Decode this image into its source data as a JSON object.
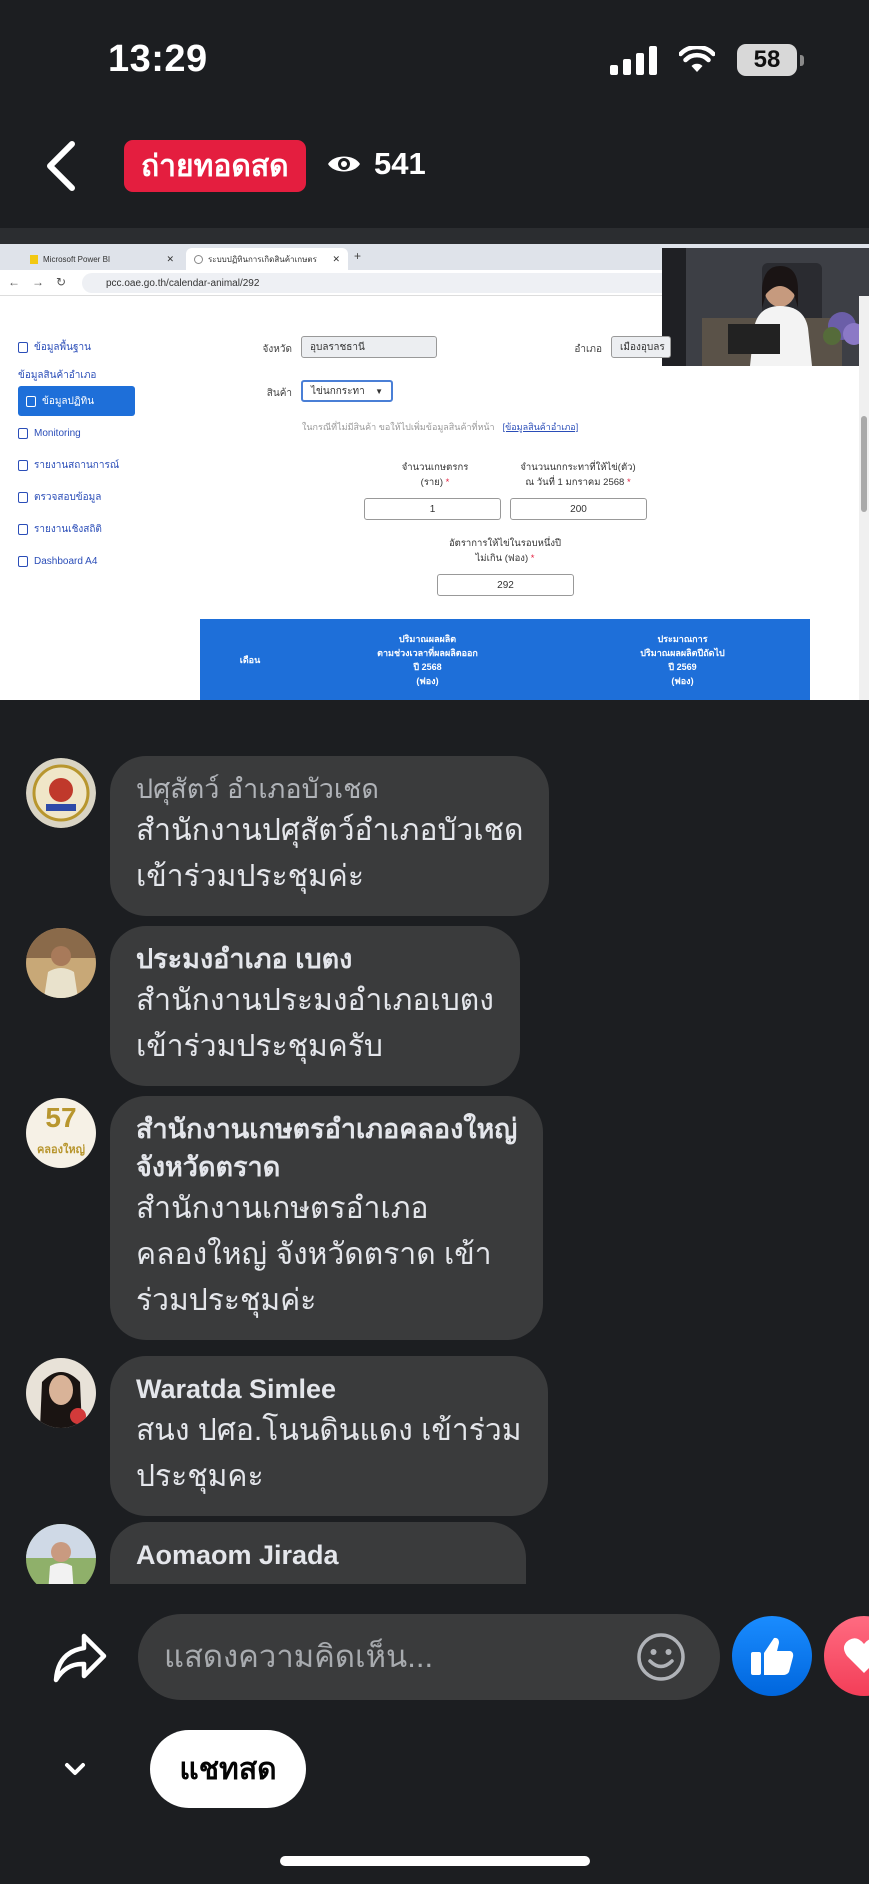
{
  "status_bar": {
    "time": "13:29",
    "battery": "58"
  },
  "header": {
    "live_label": "ถ่ายทอดสด",
    "viewer_count": "541"
  },
  "video": {
    "tabs": [
      {
        "label": "Microsoft Power BI"
      },
      {
        "label": "ระบบปฏิทินการเกิดสินค้าเกษตร"
      }
    ],
    "url": "pcc.oae.go.th/calendar-animal/292",
    "sidebar": [
      {
        "label": "ข้อมูลพื้นฐาน"
      },
      {
        "label": "ข้อมูลสินค้าอำเภอ"
      },
      {
        "label": "ข้อมูลปฏิทิน"
      },
      {
        "label": "Monitoring"
      },
      {
        "label": "รายงานสถานการณ์"
      },
      {
        "label": "ตรวจสอบข้อมูล"
      },
      {
        "label": "รายงานเชิงสถิติ"
      },
      {
        "label": "Dashboard A4"
      }
    ],
    "form": {
      "province_label": "จังหวัด",
      "province_value": "อุบลราชธานี",
      "district_label": "อำเภอ",
      "district_value": "เมืองอุบลร",
      "product_label": "สินค้า",
      "product_value": "ไข่นกกระทา",
      "hint": "ในกรณีที่ไม่มีสินค้า ขอให้ไปเพิ่มข้อมูลสินค้าที่หน้า",
      "hint_link": "[ข้อมูลสินค้าอำเภอ]",
      "farmers_label_1": "จำนวนเกษตรกร",
      "farmers_label_2": "(ราย)",
      "farmers_value": "1",
      "birds_label_1": "จำนวนนกกระทาที่ให้ไข่(ตัว)",
      "birds_label_2": "ณ วันที่ 1 มกราคม 2568",
      "birds_value": "200",
      "rate_label_1": "อัตราการให้ไข่ในรอบหนึ่งปี",
      "rate_label_2": "ไม่เกิน (ฟอง)",
      "rate_value": "292",
      "required_mark": "*"
    },
    "table": {
      "col_month": "เดือน",
      "col_2568_l1": "ปริมาณผลผลิต",
      "col_2568_l2": "ตามช่วงเวลาที่ผลผลิตออก",
      "col_2568_l3": "ปี 2568",
      "col_2568_l4": "(ฟอง)",
      "col_2569_l1": "ประมาณการ",
      "col_2569_l2": "ปริมาณผลผลิตปีถัดไป",
      "col_2569_l3": "ปี 2569",
      "col_2569_l4": "(ฟอง)"
    }
  },
  "comments": [
    {
      "name": "ปศุสัตว์ อำเภอบัวเชด",
      "lines": [
        "สำนักงานปศุสัตว์อำเภอบัวเชด",
        "เข้าร่วมประชุมค่ะ"
      ]
    },
    {
      "name": "ประมงอำเภอ เบตง",
      "lines": [
        "สำนักงานประมงอำเภอเบตง",
        "เข้าร่วมประชุมครับ"
      ]
    },
    {
      "name_1": "สำนักงานเกษตรอำเภอคลองใหญ่",
      "name_2": "จังหวัดตราด",
      "lines": [
        "สำนักงานเกษตรอำเภอ",
        "คลองใหญ่ จังหวัดตราด เข้า",
        "ร่วมประชุมค่ะ"
      ],
      "avatar_number": "57",
      "avatar_text": "คลองใหญ่"
    },
    {
      "name": "Waratda Simlee",
      "lines": [
        "สนง ปศอ.โนนดินแดง เข้าร่วม",
        "ประชุมคะ"
      ]
    },
    {
      "name": "Aomaom Jirada"
    }
  ],
  "composer": {
    "placeholder": "แสดงความคิดเห็น..."
  },
  "live_chat_label": "แชทสด",
  "colors": {
    "live_red": "#e41e3f",
    "like_blue": "#1877f2",
    "bubble": "#3a3b3c",
    "background": "#1c1e21"
  }
}
